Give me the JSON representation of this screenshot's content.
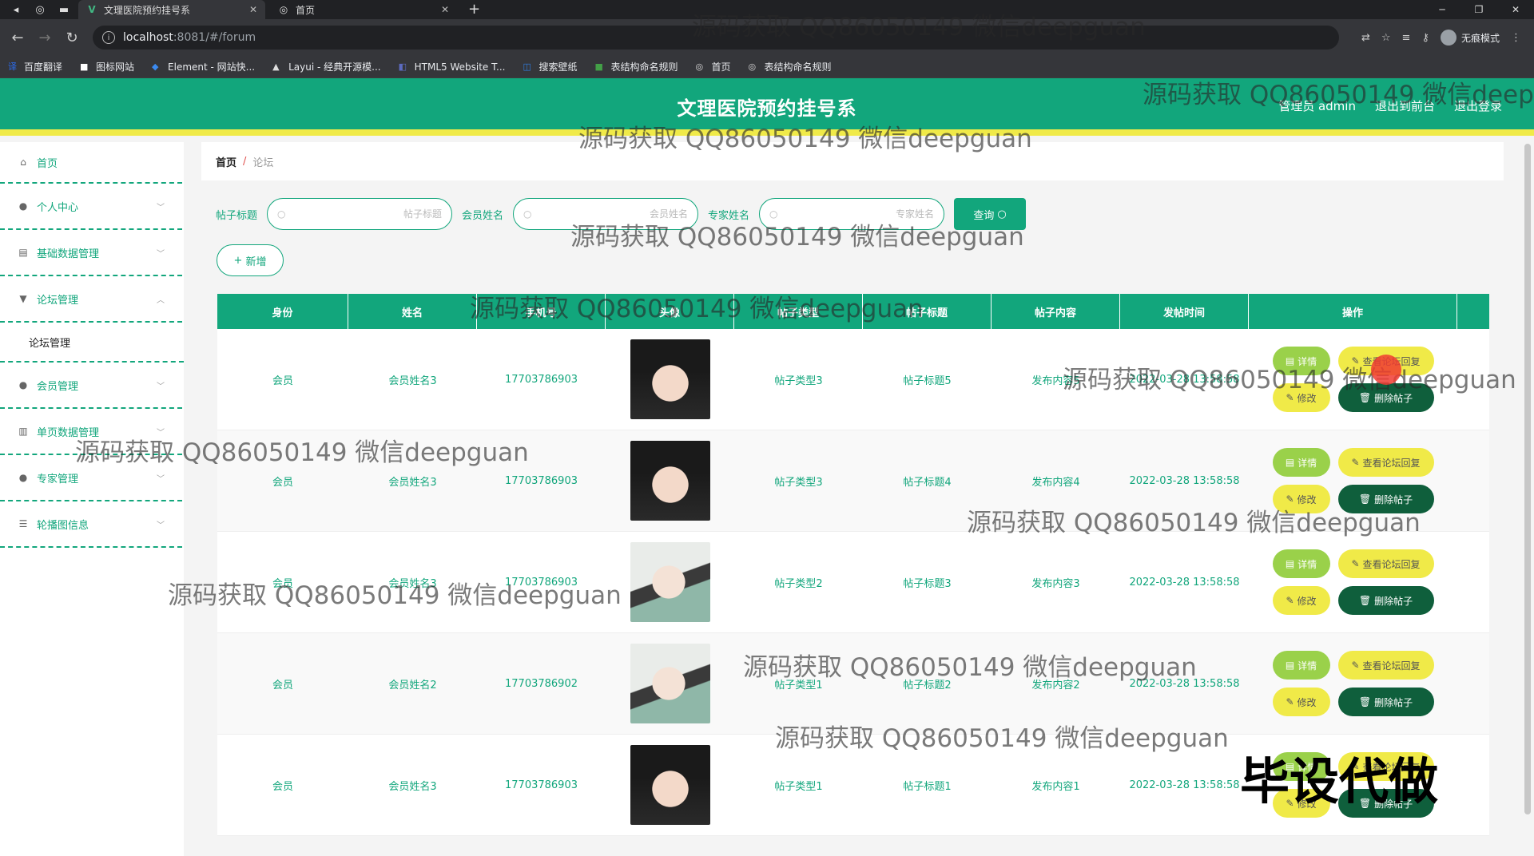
{
  "browser": {
    "tabs": [
      {
        "title": "文理医院预约挂号系",
        "active": true
      },
      {
        "title": "首页",
        "active": false
      }
    ],
    "url_host": "localhost",
    "url_rest": ":8081/#/forum",
    "profile": "无痕模式",
    "bookmarks": [
      "百度翻译",
      "图标网站",
      "Element - 网站快...",
      "Layui - 经典开源模...",
      "HTML5 Website T...",
      "搜索壁纸",
      "表结构命名规则",
      "首页",
      "表结构命名规则"
    ]
  },
  "header": {
    "title": "文理医院预约挂号系",
    "admin": "管理员 admin",
    "back": "退出到前台",
    "logout": "退出登录"
  },
  "sidebar": {
    "items": [
      {
        "label": "首页",
        "icon": "home-icon"
      },
      {
        "label": "个人中心",
        "icon": "user-icon"
      },
      {
        "label": "基础数据管理",
        "icon": "clipboard-icon"
      },
      {
        "label": "论坛管理",
        "icon": "comment-icon",
        "open": true,
        "sub": "论坛管理"
      },
      {
        "label": "会员管理",
        "icon": "user-icon"
      },
      {
        "label": "单页数据管理",
        "icon": "chart-icon"
      },
      {
        "label": "专家管理",
        "icon": "user-icon"
      },
      {
        "label": "轮播图信息",
        "icon": "list-icon"
      }
    ]
  },
  "breadcrumb": {
    "home": "首页",
    "sep": "/",
    "current": "论坛"
  },
  "search": {
    "title_label": "帖子标题",
    "title_placeholder": "帖子标题",
    "member_label": "会员姓名",
    "member_placeholder": "会员姓名",
    "expert_label": "专家姓名",
    "expert_placeholder": "专家姓名",
    "query": "查询"
  },
  "add_label": "新增",
  "table": {
    "headers": [
      "身份",
      "姓名",
      "手机号",
      "头像",
      "帖子类型",
      "帖子标题",
      "帖子内容",
      "发帖时间",
      "操作"
    ],
    "rows": [
      {
        "role": "会员",
        "name": "会员姓名3",
        "phone": "17703786903",
        "photo": "dark",
        "type": "帖子类型3",
        "title": "帖子标题5",
        "content": "发布内容5",
        "time": "2022-03-28 13:58:58"
      },
      {
        "role": "会员",
        "name": "会员姓名3",
        "phone": "17703786903",
        "photo": "dark",
        "type": "帖子类型3",
        "title": "帖子标题4",
        "content": "发布内容4",
        "time": "2022-03-28 13:58:58"
      },
      {
        "role": "会员",
        "name": "会员姓名3",
        "phone": "17703786903",
        "photo": "light",
        "type": "帖子类型2",
        "title": "帖子标题3",
        "content": "发布内容3",
        "time": "2022-03-28 13:58:58"
      },
      {
        "role": "会员",
        "name": "会员姓名2",
        "phone": "17703786902",
        "photo": "light",
        "type": "帖子类型1",
        "title": "帖子标题2",
        "content": "发布内容2",
        "time": "2022-03-28 13:58:58"
      },
      {
        "role": "会员",
        "name": "会员姓名3",
        "phone": "17703786903",
        "photo": "dark",
        "type": "帖子类型1",
        "title": "帖子标题1",
        "content": "发布内容1",
        "time": "2022-03-28 13:58:58"
      }
    ],
    "ops": {
      "detail": "详情",
      "view_reply": "查看论坛回复",
      "edit": "修改",
      "delete": "删除帖子"
    }
  },
  "watermarks": {
    "text": "源码获取 QQ86050149 微信deepguan",
    "big": "毕设代做"
  },
  "colors": {
    "primary": "#12a67c",
    "accent": "#f0ea48",
    "danger": "#0f5f3c"
  }
}
